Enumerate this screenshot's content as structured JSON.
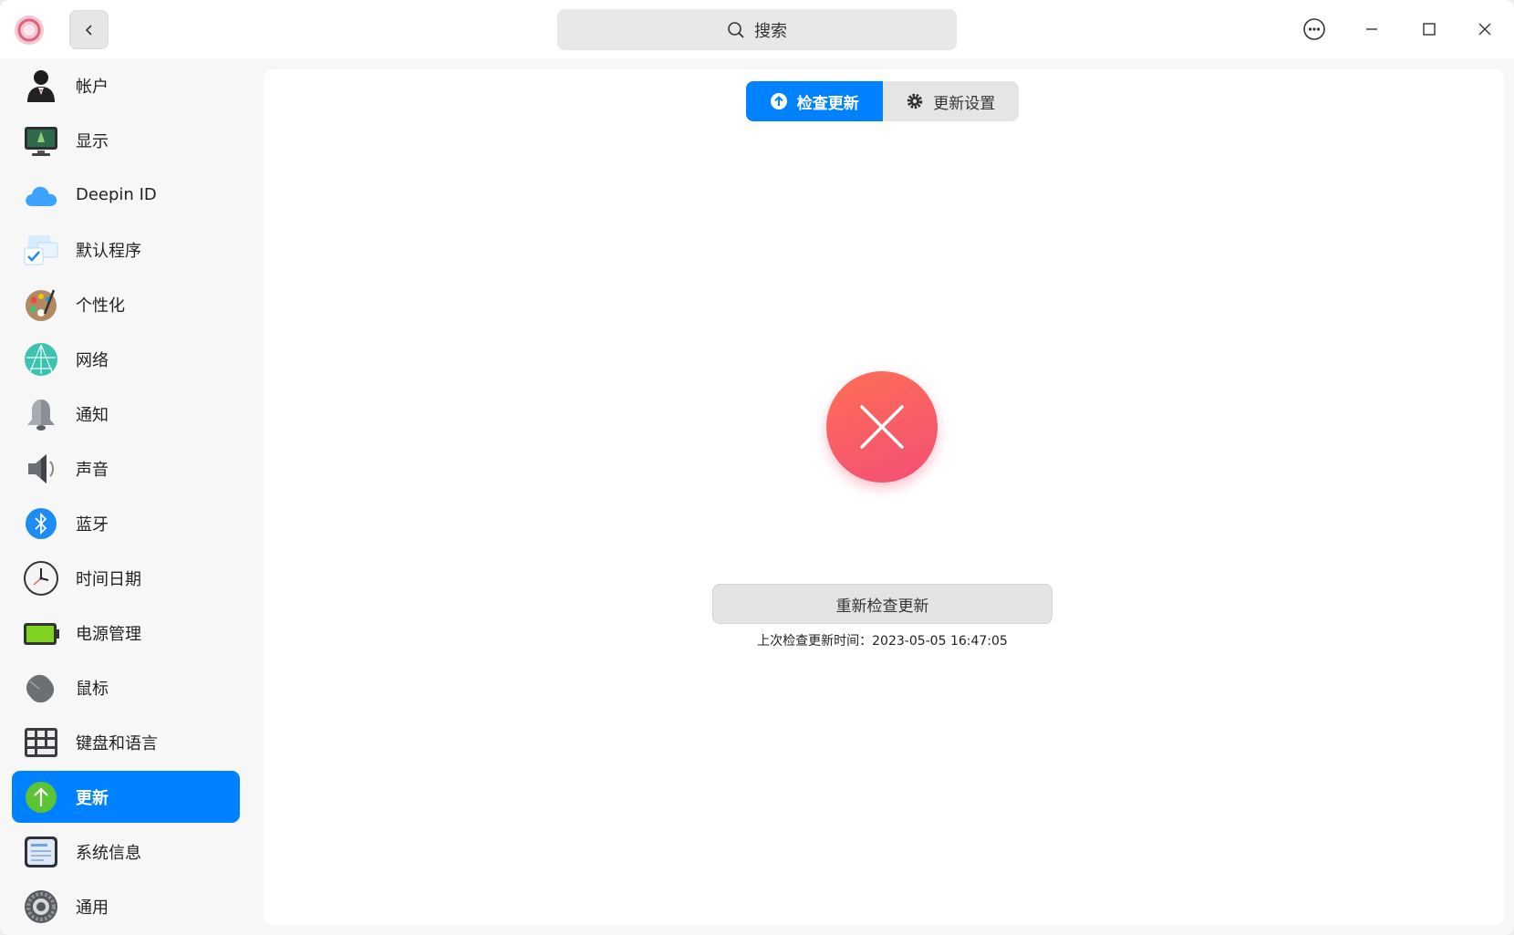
{
  "search": {
    "placeholder": "搜索"
  },
  "sidebar": {
    "items": [
      {
        "label": "帐户",
        "icon": "account-icon"
      },
      {
        "label": "显示",
        "icon": "display-icon"
      },
      {
        "label": "Deepin ID",
        "icon": "cloud-icon"
      },
      {
        "label": "默认程序",
        "icon": "default-apps-icon"
      },
      {
        "label": "个性化",
        "icon": "palette-icon"
      },
      {
        "label": "网络",
        "icon": "network-icon"
      },
      {
        "label": "通知",
        "icon": "bell-icon"
      },
      {
        "label": "声音",
        "icon": "speaker-icon"
      },
      {
        "label": "蓝牙",
        "icon": "bluetooth-icon"
      },
      {
        "label": "时间日期",
        "icon": "clock-icon"
      },
      {
        "label": "电源管理",
        "icon": "battery-icon"
      },
      {
        "label": "鼠标",
        "icon": "mouse-icon"
      },
      {
        "label": "键盘和语言",
        "icon": "keyboard-icon"
      },
      {
        "label": "更新",
        "icon": "update-icon",
        "active": true
      },
      {
        "label": "系统信息",
        "icon": "system-info-icon"
      },
      {
        "label": "通用",
        "icon": "gear-icon"
      }
    ]
  },
  "tabs": {
    "check": "检查更新",
    "settings": "更新设置"
  },
  "status": {
    "retry_label": "重新检查更新",
    "last_check": "上次检查更新时间：2023-05-05 16:47:05"
  },
  "colors": {
    "accent": "#0081ff",
    "error_start": "#ff6e55",
    "error_end": "#f24f76"
  }
}
